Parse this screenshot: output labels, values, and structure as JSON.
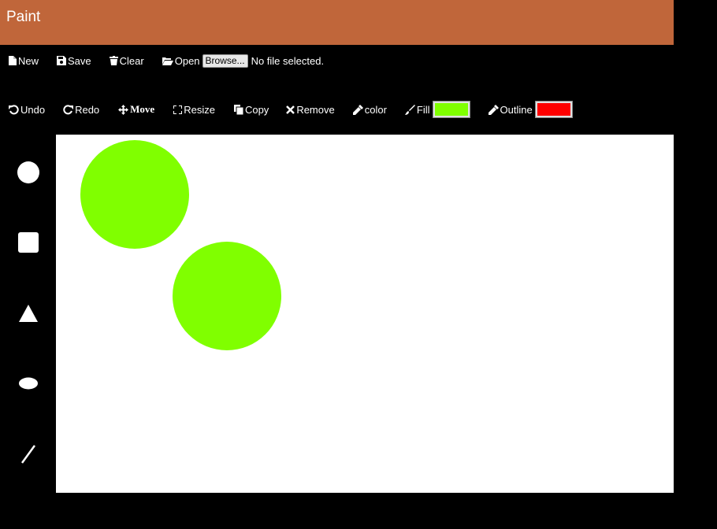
{
  "app": {
    "title": "Paint"
  },
  "file_toolbar": {
    "new_label": "New",
    "save_label": "Save",
    "clear_label": "Clear",
    "open_label": "Open",
    "browse_label": "Browse...",
    "file_status": "No file selected."
  },
  "edit_toolbar": {
    "undo_label": "Undo",
    "redo_label": "Redo",
    "move_label": "Move",
    "resize_label": "Resize",
    "copy_label": "Copy",
    "remove_label": "Remove",
    "color_label": "color",
    "fill_label": "Fill",
    "fill_color": "#80ff00",
    "outline_label": "Outline",
    "outline_color": "#ff0000"
  },
  "shape_tools": [
    "circle-icon",
    "square-icon",
    "triangle-icon",
    "ellipse-icon",
    "line-icon"
  ],
  "canvas_shapes": [
    {
      "type": "circle",
      "fill": "#80ff00"
    },
    {
      "type": "circle",
      "fill": "#80ff00"
    }
  ]
}
